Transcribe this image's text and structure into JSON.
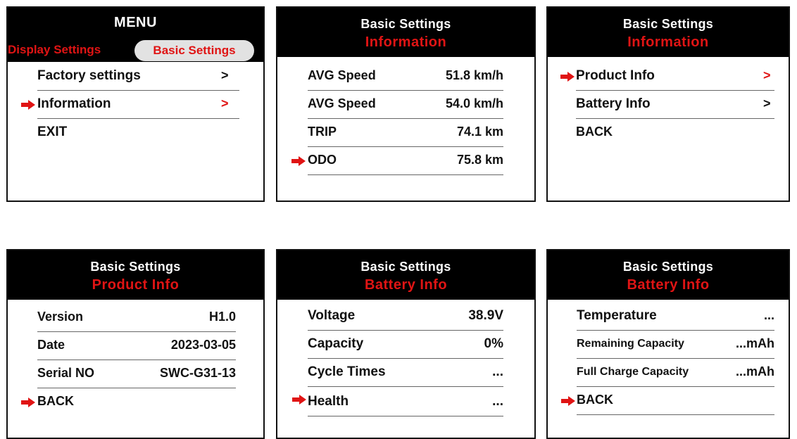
{
  "colors": {
    "accent_red": "#e01414",
    "header_bg": "#000000",
    "text": "#111111",
    "pill_bg": "#e2e2e2"
  },
  "panels": {
    "menu": {
      "title": "MENU",
      "tabs": [
        "Display Settings",
        "Basic Settings"
      ],
      "items": [
        {
          "label": "Factory settings",
          "chevron": ">"
        },
        {
          "label": "Information",
          "chevron": ">",
          "selected": true
        },
        {
          "label": "EXIT"
        }
      ]
    },
    "information": {
      "title": "Basic Settings",
      "subtitle": "Information",
      "rows": [
        {
          "label": "AVG Speed",
          "value": "51.8 km/h"
        },
        {
          "label": "AVG Speed",
          "value": "54.0 km/h"
        },
        {
          "label": "TRIP",
          "value": "74.1 km"
        },
        {
          "label": "ODO",
          "value": "75.8 km",
          "selected": true
        }
      ]
    },
    "info_menu": {
      "title": "Basic Settings",
      "subtitle": "Information",
      "items": [
        {
          "label": "Product Info",
          "chevron": ">",
          "selected": true
        },
        {
          "label": "Battery Info",
          "chevron": ">"
        },
        {
          "label": "BACK"
        }
      ]
    },
    "product_info": {
      "title": "Basic Settings",
      "subtitle": "Product Info",
      "rows": [
        {
          "label": "Version",
          "value": "H1.0"
        },
        {
          "label": "Date",
          "value": "2023-03-05"
        },
        {
          "label": "Serial NO",
          "value": "SWC-G31-13"
        },
        {
          "label": "BACK",
          "selected": true
        }
      ]
    },
    "battery_info_1": {
      "title": "Basic Settings",
      "subtitle": "Battery Info",
      "rows": [
        {
          "label": "Voltage",
          "value": "38.9V"
        },
        {
          "label": "Capacity",
          "value": "0%"
        },
        {
          "label": "Cycle Times",
          "value": "..."
        },
        {
          "label": "Health",
          "value": "...",
          "selected": true
        }
      ]
    },
    "battery_info_2": {
      "title": "Basic Settings",
      "subtitle": "Battery Info",
      "rows": [
        {
          "label": "Temperature",
          "value": "..."
        },
        {
          "label": "Remaining Capacity",
          "value": "...mAh"
        },
        {
          "label": "Full Charge Capacity",
          "value": "...mAh"
        },
        {
          "label": "BACK",
          "selected": true
        }
      ]
    }
  }
}
